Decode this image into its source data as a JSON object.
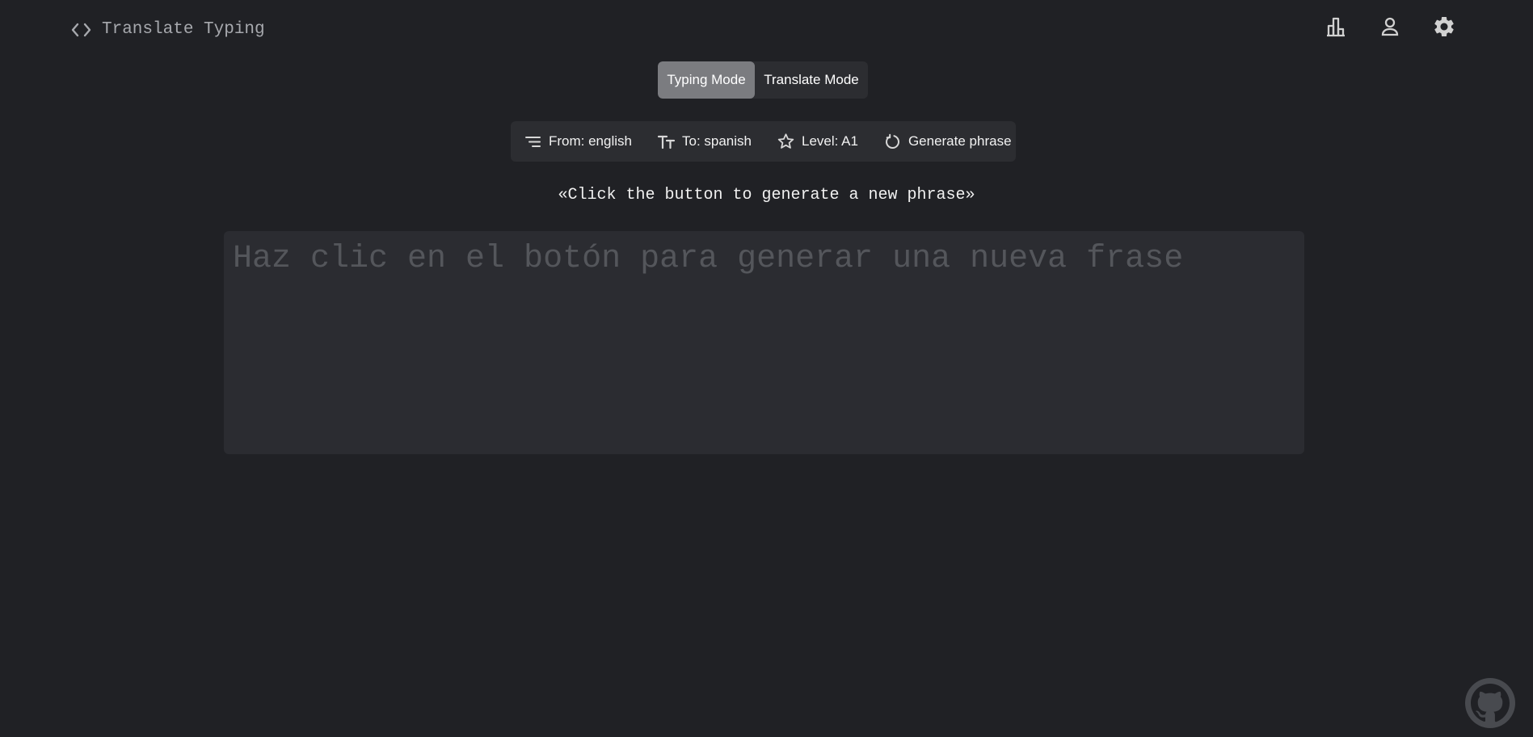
{
  "header": {
    "brand_text": "Translate Typing",
    "brand_icon": "code-icon",
    "actions": [
      {
        "name": "leaderboard",
        "icon": "bar-chart-icon"
      },
      {
        "name": "profile",
        "icon": "user-icon"
      },
      {
        "name": "settings",
        "icon": "gear-icon"
      }
    ]
  },
  "mode_switch": {
    "typing_mode": "Typing Mode",
    "translate_mode": "Translate Mode",
    "active": "Typing Mode"
  },
  "toolbar": {
    "from_label": "From: english",
    "to_label": "To: spanish",
    "level_label": "Level: A1",
    "generate_label": "Generate phrase"
  },
  "main": {
    "hint": "«Click the button to generate a new phrase»",
    "phrase_placeholder": "Haz clic en el botón para generar una nueva frase"
  },
  "footer": {
    "github_icon": "github-icon"
  },
  "colors": {
    "background": "#202125",
    "surface": "#2c2d31",
    "active_mode": "#7b7c80",
    "placeholder": "#54565b"
  }
}
